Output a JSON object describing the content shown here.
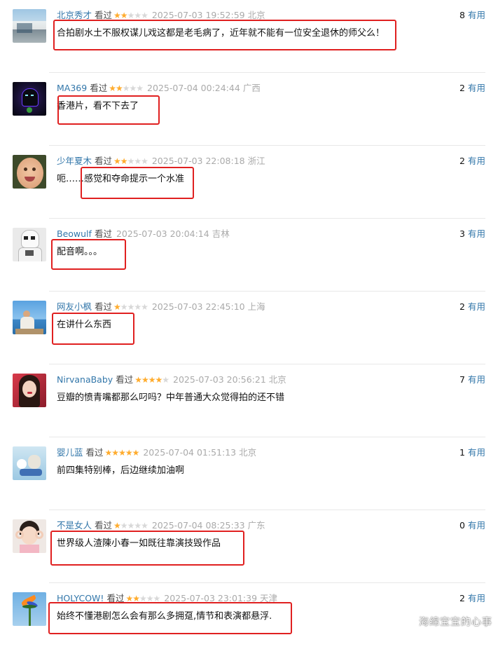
{
  "reviews": [
    {
      "user": "北京秀才",
      "status": "看过",
      "rating": 2,
      "time": "2025-07-03 19:52:59",
      "location": "北京",
      "votes": "8",
      "votes_label": "有用",
      "comment": "合拍剧水土不服权谋儿戏这都是老毛病了，近年就不能有一位安全退休的师父么！",
      "avatar": "window-scene"
    },
    {
      "user": "MA369",
      "status": "看过",
      "rating": 2,
      "time": "2025-07-04 00:24:44",
      "location": "广西",
      "votes": "2",
      "votes_label": "有用",
      "comment": "香港片，看不下去了",
      "avatar": "hooded-figure"
    },
    {
      "user": "少年夏木",
      "status": "看过",
      "rating": 2,
      "time": "2025-07-03 22:08:18",
      "location": "浙江",
      "votes": "2",
      "votes_label": "有用",
      "comment": "呃……感觉和夺命提示一个水准",
      "avatar": "child-face"
    },
    {
      "user": "Beowulf",
      "status": "看过",
      "rating": 0,
      "time": "2025-07-03 20:04:14",
      "location": "吉林",
      "votes": "3",
      "votes_label": "有用",
      "comment": "配音啊。。。",
      "avatar": "stormtrooper"
    },
    {
      "user": "网友小枫",
      "status": "看过",
      "rating": 1,
      "time": "2025-07-03 22:45:10",
      "location": "上海",
      "votes": "2",
      "votes_label": "有用",
      "comment": "在讲什么东西",
      "avatar": "person-sky"
    },
    {
      "user": "NirvanaBaby",
      "status": "看过",
      "rating": 4,
      "time": "2025-07-03 20:56:21",
      "location": "北京",
      "votes": "7",
      "votes_label": "有用",
      "comment": "豆瓣的愤青嘴都那么叼吗？中年普通大众觉得拍的还不错",
      "avatar": "woman-red"
    },
    {
      "user": "婴儿蓝",
      "status": "看过",
      "rating": 5,
      "time": "2025-07-04 01:51:13",
      "location": "北京",
      "votes": "1",
      "votes_label": "有用",
      "comment": "前四集特别棒，后边继续加油啊",
      "avatar": "figurine"
    },
    {
      "user": "不是女人",
      "status": "看过",
      "rating": 1,
      "time": "2025-07-04 08:25:33",
      "location": "广东",
      "votes": "0",
      "votes_label": "有用",
      "comment": "世界级人渣陳小春一如既往靠演技毁作品",
      "avatar": "girl-hands"
    },
    {
      "user": "HOLYCOW!",
      "status": "看过",
      "rating": 2,
      "time": "2025-07-03 23:01:39",
      "location": "天津",
      "votes": "2",
      "votes_label": "有用",
      "comment": "始终不懂港剧怎么会有那么多拥趸,情节和表演都悬浮.",
      "avatar": "bird-of-paradise"
    }
  ],
  "watermark": "海绵宝宝的心事",
  "colors": {
    "link": "#3377aa",
    "star_on": "#ffac2d",
    "star_off": "#d8d8d8",
    "meta_gray": "#aaaaaa",
    "highlight_red": "#e02020",
    "divider": "#e8e8e8"
  }
}
